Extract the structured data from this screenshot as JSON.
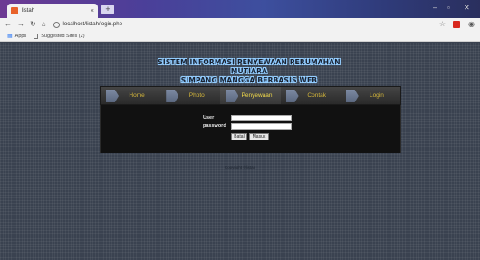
{
  "browser": {
    "tab_title": "listah",
    "tab_close": "×",
    "new_tab": "+",
    "url": "localhost/listah/login.php",
    "bookmarks": [
      "Apps",
      "Suggested Sites (2)"
    ]
  },
  "site": {
    "header_line1": "SISTEM INFORMASI PENYEWAAN PERUMAHAN MUTIARA",
    "header_line2": "SIMPANG MANGGA BERBASIS WEB",
    "nav": [
      "Home",
      "Photo",
      "Penyewaan",
      "Contak",
      "Login"
    ],
    "active_nav": "Penyewaan",
    "form": {
      "user_label": "User",
      "password_label": "password",
      "user_value": "",
      "password_value": "",
      "reset_label": "Batal",
      "submit_label": "Masuk"
    },
    "copyright": "Copyright ©listah"
  },
  "colors": {
    "page_bg": "#3a4250",
    "nav_text": "#d4b63a",
    "header_glow": "#7ec0ff"
  }
}
